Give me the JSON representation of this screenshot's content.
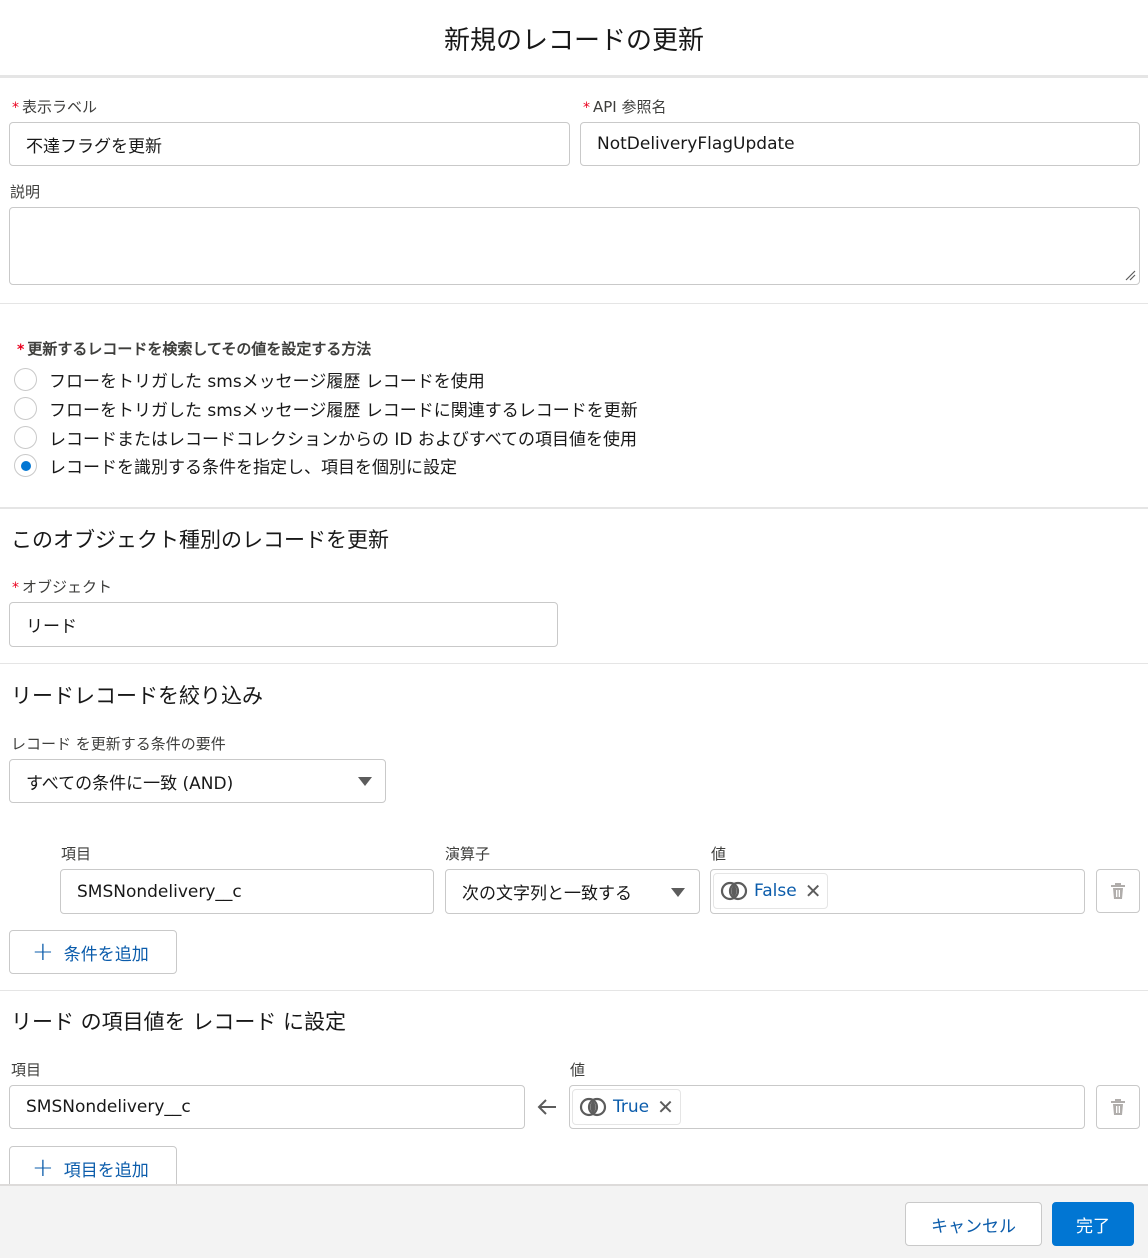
{
  "modal": {
    "title": "新規のレコードの更新"
  },
  "fields": {
    "label": {
      "label": "表示ラベル",
      "value": "不達フラグを更新"
    },
    "api_name": {
      "label": "API 参照名",
      "value": "NotDeliveryFlagUpdate"
    },
    "description": {
      "label": "説明",
      "value": ""
    }
  },
  "method": {
    "heading": "更新するレコードを検索してその値を設定する方法",
    "options": [
      {
        "label": "フローをトリガした smsメッセージ履歴 レコードを使用",
        "checked": false
      },
      {
        "label": "フローをトリガした smsメッセージ履歴 レコードに関連するレコードを更新",
        "checked": false
      },
      {
        "label": "レコードまたはレコードコレクションからの ID およびすべての項目値を使用",
        "checked": false
      },
      {
        "label": "レコードを識別する条件を指定し、項目を個別に設定",
        "checked": true
      }
    ]
  },
  "object_section": {
    "title": "このオブジェクト種別のレコードを更新",
    "object_label": "オブジェクト",
    "object_value": "リード"
  },
  "filter_section": {
    "title": "リードレコードを絞り込み",
    "requirement_label": "レコード を更新する条件の要件",
    "requirement_value": "すべての条件に一致 (AND)",
    "col_field": "項目",
    "col_operator": "演算子",
    "col_value": "値",
    "row": {
      "field": "SMSNondelivery__c",
      "operator": "次の文字列と一致する",
      "value": "False"
    },
    "add_label": "条件を追加"
  },
  "set_section": {
    "title": "リード の項目値を レコード に設定",
    "col_field": "項目",
    "col_value": "値",
    "row": {
      "field": "SMSNondelivery__c",
      "value": "True"
    },
    "add_label": "項目を追加"
  },
  "footer": {
    "cancel_label": "キャンセル",
    "done_label": "完了"
  },
  "colors": {
    "brand": "#0176d3",
    "link": "#0b5cab",
    "required": "#ea001e"
  },
  "icons": {
    "boolean": "boolean-toggle-icon",
    "trash": "trash-icon",
    "arrow": "arrow-left-icon",
    "close": "close-icon",
    "plus": "plus-icon"
  }
}
